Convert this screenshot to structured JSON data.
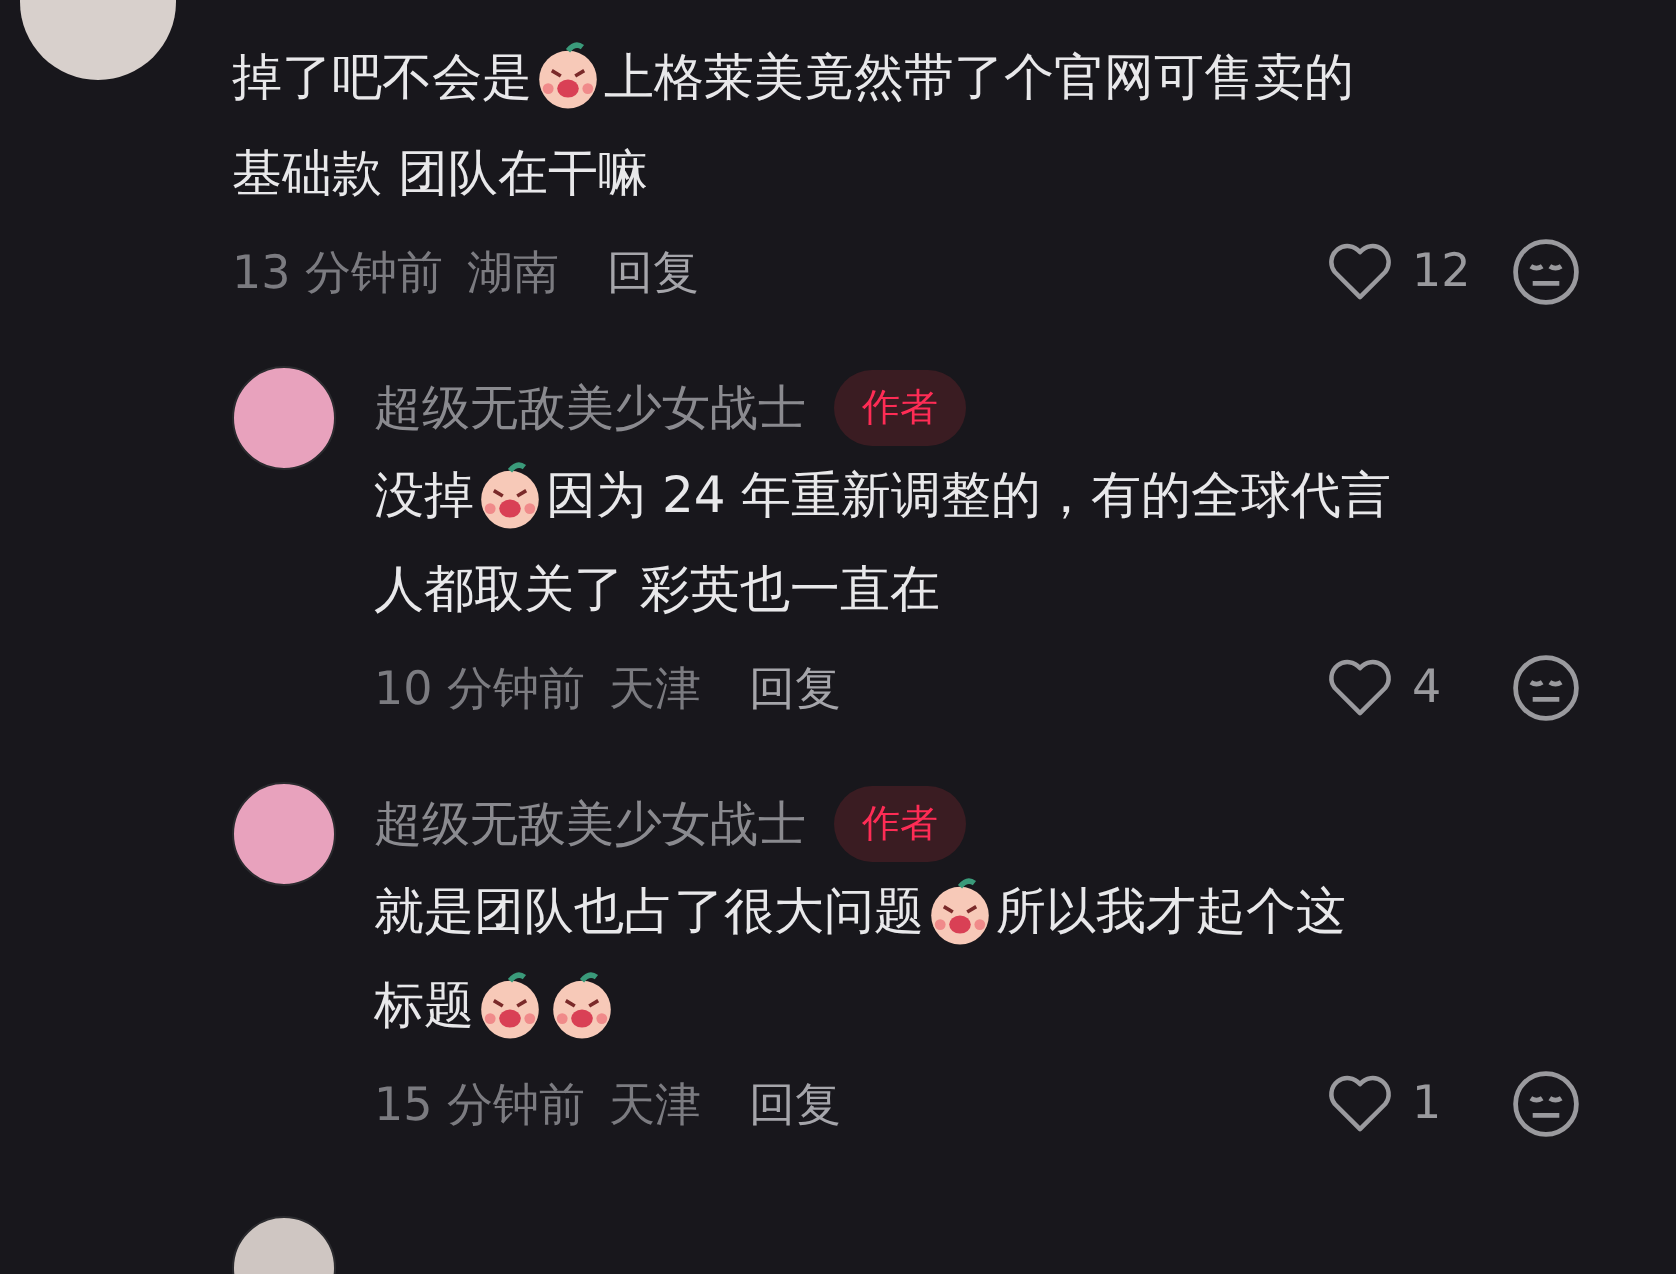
{
  "comment": {
    "lines": [
      [
        {
          "kind": "text",
          "text": "掉了吧不会是"
        },
        {
          "kind": "sticker"
        },
        {
          "kind": "text",
          "text": "上格莱美竟然带了个官网可售卖的"
        }
      ],
      [
        {
          "kind": "text",
          "text": "基础款 团队在干嘛"
        }
      ]
    ],
    "time": "13 分钟前",
    "location": "湖南",
    "reply": "回复",
    "likes": "12",
    "liked": false
  },
  "replies": [
    {
      "author": "超级无敌美少女战士",
      "badge": "作者",
      "lines": [
        [
          {
            "kind": "text",
            "text": "没掉"
          },
          {
            "kind": "sticker"
          },
          {
            "kind": "text",
            "text": "因为 24 年重新调整的，有的全球代言"
          }
        ],
        [
          {
            "kind": "text",
            "text": "人都取关了 彩英也一直在"
          }
        ]
      ],
      "time": "10 分钟前",
      "location": "天津",
      "reply": "回复",
      "likes": "4",
      "liked": false
    },
    {
      "author": "超级无敌美少女战士",
      "badge": "作者",
      "lines": [
        [
          {
            "kind": "text",
            "text": "就是团队也占了很大问题"
          },
          {
            "kind": "sticker"
          },
          {
            "kind": "text",
            "text": "所以我才起个这"
          }
        ],
        [
          {
            "kind": "text",
            "text": "标题"
          },
          {
            "kind": "sticker"
          },
          {
            "kind": "sticker"
          }
        ]
      ],
      "time": "15 分钟前",
      "location": "天津",
      "reply": "回复",
      "likes": "1",
      "liked": false
    }
  ],
  "next_reply_visible": true
}
